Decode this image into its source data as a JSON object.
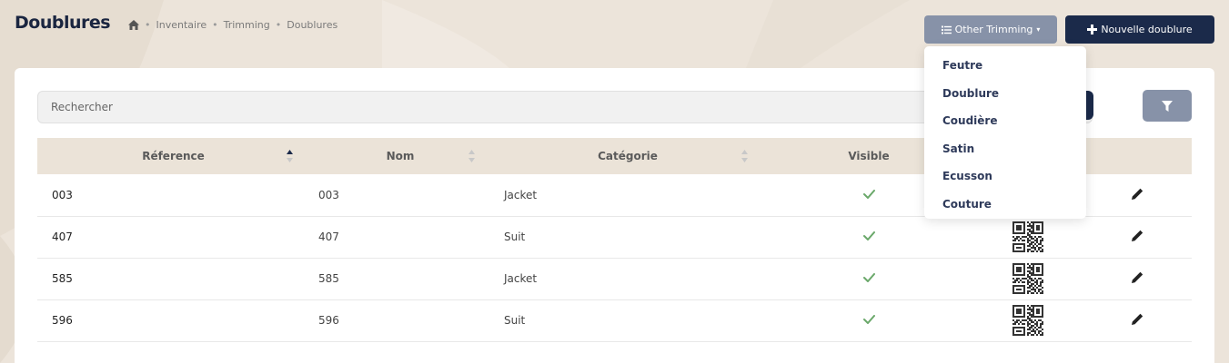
{
  "header": {
    "title": "Doublures",
    "breadcrumb": {
      "home_icon": "home-icon",
      "items": [
        "Inventaire",
        "Trimming",
        "Doublures"
      ],
      "separator": "•"
    },
    "other_button": {
      "label": "Other Trimming",
      "icon": "list-icon",
      "caret": "▾"
    },
    "new_button": {
      "label": "Nouvelle doublure",
      "icon": "plus-icon"
    }
  },
  "dropdown": {
    "items": [
      "Feutre",
      "Doublure",
      "Coudière",
      "Satin",
      "Ecusson",
      "Couture"
    ]
  },
  "search": {
    "placeholder": "Rechercher",
    "value": ""
  },
  "table": {
    "columns": [
      "Réference",
      "Nom",
      "Catégorie",
      "Visible"
    ],
    "rows": [
      {
        "ref": "003",
        "nom": "003",
        "cat": "Jacket",
        "visible": true,
        "qr_visible": false
      },
      {
        "ref": "407",
        "nom": "407",
        "cat": "Suit",
        "visible": true,
        "qr_visible": true
      },
      {
        "ref": "585",
        "nom": "585",
        "cat": "Jacket",
        "visible": true,
        "qr_visible": true
      },
      {
        "ref": "596",
        "nom": "596",
        "cat": "Suit",
        "visible": true,
        "qr_visible": true
      }
    ]
  },
  "colors": {
    "primary": "#1b2a4a",
    "secondary": "#8792a8",
    "check": "#6aa86a",
    "header_bg": "#ebe3d8",
    "page_bg": "#ece4da"
  }
}
